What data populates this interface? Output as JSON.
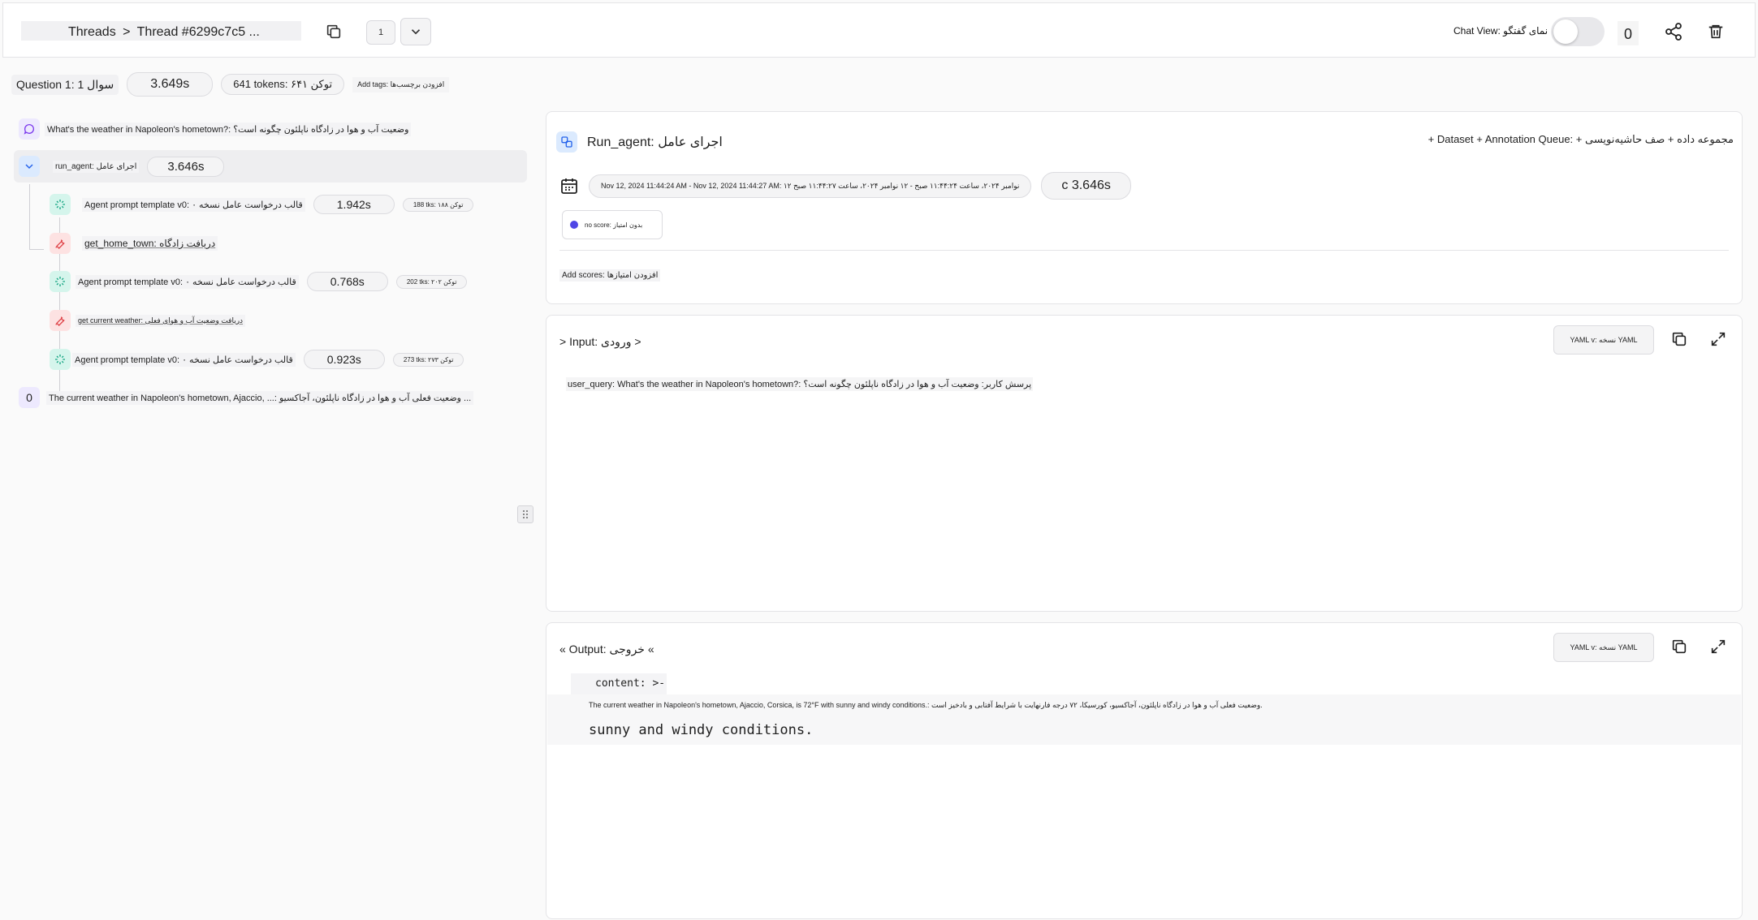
{
  "header": {
    "breadcrumb_root": "Threads",
    "breadcrumb_sep": ">",
    "breadcrumb_current": "Thread #6299c7c5 ...",
    "page_indicator": "1",
    "chat_view_label": "Chat View: نمای گفتگو",
    "chat_view_enabled": false,
    "count": "0",
    "icons": [
      "copy-icon",
      "chevron-down-icon",
      "share-icon",
      "trash-icon"
    ]
  },
  "question": {
    "label": "Question 1: سوال 1",
    "latency": "3.649s",
    "tokens": "641 tokens: توکن ۶۴۱",
    "add_tags": "Add tags: افزودن برچسب‌ها"
  },
  "trace": {
    "user_message": "What's the weather in Napoleon's hometown?: وضعیت آب و هوا در زادگاه ناپلئون چگونه است؟",
    "run_agent": {
      "label": "run_agent: اجرای عامل",
      "latency": "3.646s"
    },
    "steps": [
      {
        "type": "llm",
        "label": "Agent prompt template v0: قالب درخواست عامل نسخه ۰",
        "latency": "1.942s",
        "tokens": "188 tks: ۱۸۸ توکن"
      },
      {
        "type": "tool",
        "label": "get_home_town: دریافت زادگاه"
      },
      {
        "type": "llm",
        "label": "Agent prompt template v0: قالب درخواست عامل نسخه ۰",
        "latency": "0.768s",
        "tokens": "202 tks: ۲۰۲ توکن"
      },
      {
        "type": "tool",
        "label": "get current weather: دریافت وضعیت آب و هوای فعلی"
      },
      {
        "type": "llm",
        "label": "Agent prompt template v0: قالب درخواست عامل نسخه ۰",
        "latency": "0.923s",
        "tokens": "273 tks: ۲۷۳ توکن"
      }
    ],
    "final_output_badge": "0",
    "final_output": "The current weather in Napoleon's hometown, Ajaccio, ...: وضعیت فعلی آب و هوا در زادگاه ناپلئون، آجاکسیو ..."
  },
  "run_detail": {
    "name": "Run_agent: اجرای عامل",
    "dataset_button": "+ Dataset + Annotation Queue: + مجموعه داده + صف حاشیه‌نویسی",
    "time_range": "Nov 12, 2024 11:44:24 AM - Nov 12, 2024 11:44:27 AM: ۱۲ نوامبر ۲۰۲۴، ساعت ۱۱:۴۴:۲۴ صبح - ۱۲ نوامبر ۲۰۲۴، ساعت ۱۱:۴۴:۲۷ صبح",
    "duration": "c 3.646s",
    "score_chip": "no score: بدون امتیاز",
    "score_color": "#4f46e5",
    "add_scores": "Add scores: افزودن امتیازها"
  },
  "input": {
    "title": "> Input: ورودی >",
    "yaml_label": "YAML v: نسخه YAML",
    "user_query": "user_query: What's the weather in Napoleon's hometown?: پرسش کاربر: وضعیت آب و هوا در زادگاه ناپلئون چگونه است؟"
  },
  "output": {
    "title": "« Output: خروجی «",
    "yaml_label": "YAML v: نسخه YAML",
    "content_key": "content: >-",
    "line1": "The current weather in Napoleon's hometown, Ajaccio, Corsica, is 72°F with sunny and windy conditions.: وضعیت فعلی آب و هوا در زادگاه ناپلئون، آجاکسیو، کورسیکا، ۷۲ درجه فارنهایت با شرایط آفتابی و بادخیز است.",
    "line2": "sunny and windy conditions."
  },
  "colors": {
    "llm": "#10a37f",
    "tool": "#e0474c",
    "chat": "#7c3aed",
    "chain": "#2563eb"
  }
}
